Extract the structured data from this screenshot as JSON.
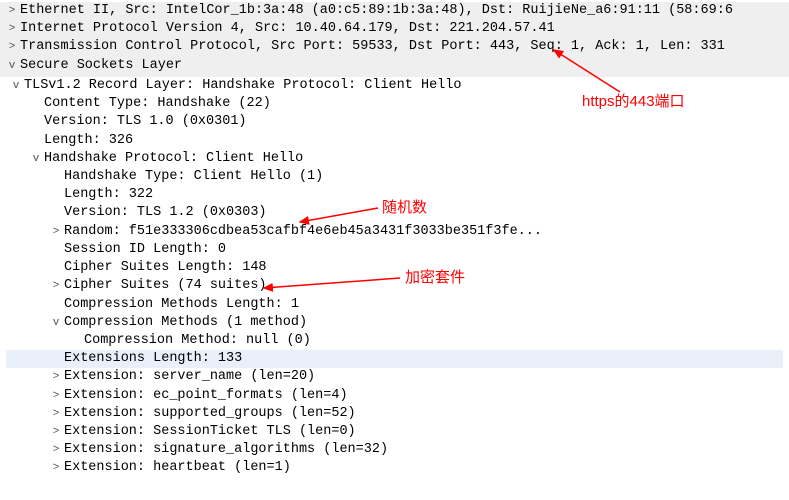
{
  "header": {
    "line0": "Ethernet II, Src: IntelCor_1b:3a:48 (a0:c5:89:1b:3a:48), Dst: RuijieNe_a6:91:11 (58:69:6",
    "line1": "Internet Protocol Version 4, Src: 10.40.64.179, Dst: 221.204.57.41",
    "line2a": "Transmission Control Protocol, Src Port: 59533, Dst Port: ",
    "line2b": "443",
    "line2c": ", Seq: 1, Ack: 1, Len: 331",
    "line3": "Secure Sockets Layer"
  },
  "tree": [
    {
      "d": 0,
      "lead": "v",
      "t": "TLSv1.2 Record Layer: Handshake Protocol: Client Hello"
    },
    {
      "d": 1,
      "lead": "",
      "t": "Content Type: Handshake (22)"
    },
    {
      "d": 1,
      "lead": "",
      "t": "Version: TLS 1.0 (0x0301)"
    },
    {
      "d": 1,
      "lead": "",
      "t": "Length: 326"
    },
    {
      "d": 1,
      "lead": "v",
      "t": "Handshake Protocol: Client Hello"
    },
    {
      "d": 2,
      "lead": "",
      "t": "Handshake Type: Client Hello (1)"
    },
    {
      "d": 2,
      "lead": "",
      "t": "Length: 322"
    },
    {
      "d": 2,
      "lead": "",
      "t": "Version: TLS 1.2 (0x0303)"
    },
    {
      "d": 2,
      "lead": ">",
      "t": "Random: f51e333306cdbea53cafbf4e6eb45a3431f3033be351f3fe..."
    },
    {
      "d": 2,
      "lead": "",
      "t": "Session ID Length: 0"
    },
    {
      "d": 2,
      "lead": "",
      "t": "Cipher Suites Length: 148"
    },
    {
      "d": 2,
      "lead": ">",
      "t": "Cipher Suites (74 suites)"
    },
    {
      "d": 2,
      "lead": "",
      "t": "Compression Methods Length: 1"
    },
    {
      "d": 2,
      "lead": "v",
      "t": "Compression Methods (1 method)"
    },
    {
      "d": 3,
      "lead": "",
      "t": "Compression Method: null (0)"
    },
    {
      "d": 2,
      "lead": "",
      "t": "Extensions Length: 133",
      "sel": true
    },
    {
      "d": 2,
      "lead": ">",
      "t": "Extension: server_name (len=20)"
    },
    {
      "d": 2,
      "lead": ">",
      "t": "Extension: ec_point_formats (len=4)"
    },
    {
      "d": 2,
      "lead": ">",
      "t": "Extension: supported_groups (len=52)"
    },
    {
      "d": 2,
      "lead": ">",
      "t": "Extension: SessionTicket TLS (len=0)"
    },
    {
      "d": 2,
      "lead": ">",
      "t": "Extension: signature_algorithms (len=32)"
    },
    {
      "d": 2,
      "lead": ">",
      "t": "Extension: heartbeat (len=1)"
    }
  ],
  "annotations": {
    "a1": "https的443端口",
    "a2": "随机数",
    "a3": "加密套件"
  }
}
